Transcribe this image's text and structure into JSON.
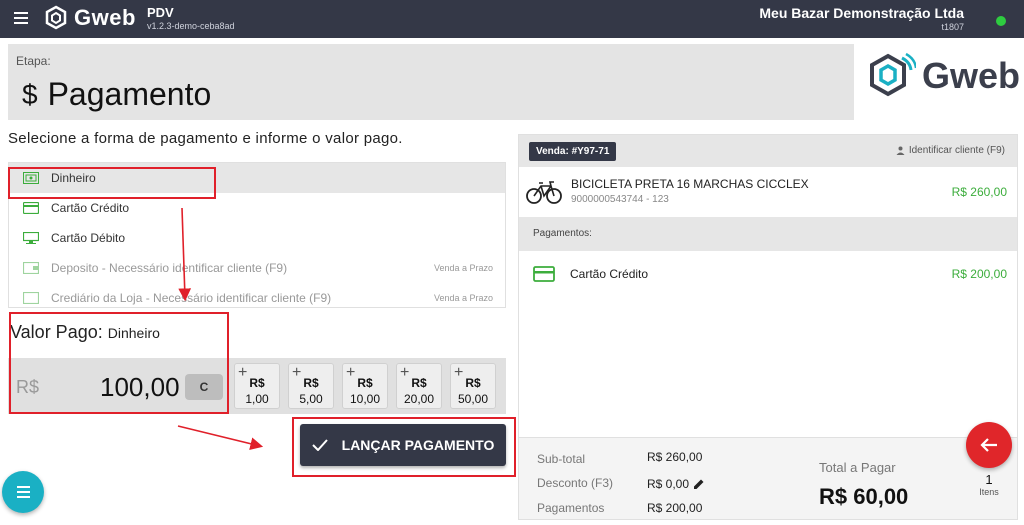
{
  "topbar": {
    "logo_text": "Gweb",
    "app_name": "PDV",
    "app_version": "v1.2.3-demo-ceba8ad",
    "store_name": "Meu Bazar Demonstração Ltda",
    "store_id": "t1807",
    "status_color": "#2ecc40"
  },
  "stage": {
    "label": "Etapa:",
    "symbol": "$",
    "title": "Pagamento"
  },
  "brand_logo_text": "Gweb",
  "instruction": "Selecione a forma de pagamento e informe o valor pago.",
  "payment_methods": [
    {
      "label": "Dinheiro",
      "icon": "cash-icon",
      "note": ""
    },
    {
      "label": "Cartão Crédito",
      "icon": "credit-card-icon",
      "note": ""
    },
    {
      "label": "Cartão Débito",
      "icon": "debit-card-icon",
      "note": ""
    },
    {
      "label": "Deposito - Necessário identificar cliente (F9)",
      "icon": "deposit-icon",
      "note": "Venda a Prazo"
    },
    {
      "label": "Crediário da Loja - Necessário identificar cliente (F9)",
      "icon": "store-credit-icon",
      "note": "Venda a Prazo"
    }
  ],
  "valor_pago": {
    "label": "Valor Pago:",
    "method": "Dinheiro",
    "currency": "R$",
    "amount": "100,00",
    "clear_label": "C"
  },
  "quick_amounts": [
    {
      "cur": "R$",
      "val": "1,00"
    },
    {
      "cur": "R$",
      "val": "5,00"
    },
    {
      "cur": "R$",
      "val": "10,00"
    },
    {
      "cur": "R$",
      "val": "20,00"
    },
    {
      "cur": "R$",
      "val": "50,00"
    }
  ],
  "launch_button": "LANÇAR PAGAMENTO",
  "sale": {
    "badge": "Venda: #Y97-71",
    "identify": "Identificar cliente (F9)",
    "product_name": "BICICLETA PRETA 16 MARCHAS CICCLEX",
    "product_sku": "9000000543744 - 123",
    "product_price": "R$ 260,00",
    "payments_header": "Pagamentos:",
    "payment_label": "Cartão Crédito",
    "payment_value": "R$ 200,00"
  },
  "summary": {
    "subtotal_label": "Sub-total",
    "subtotal_value": "R$ 260,00",
    "discount_label": "Desconto (F3)",
    "discount_value": "R$ 0,00",
    "payments_label": "Pagamentos",
    "payments_value": "R$ 200,00",
    "total_label": "Total a Pagar",
    "total_value": "R$ 60,00",
    "items_count": "1",
    "items_label": "Itens"
  },
  "colors": {
    "topbar": "#343847",
    "accent_green": "#3cad3c",
    "highlight_red": "#e0202a",
    "fab_teal": "#1ab0c4",
    "fab_red": "#e0262a"
  }
}
